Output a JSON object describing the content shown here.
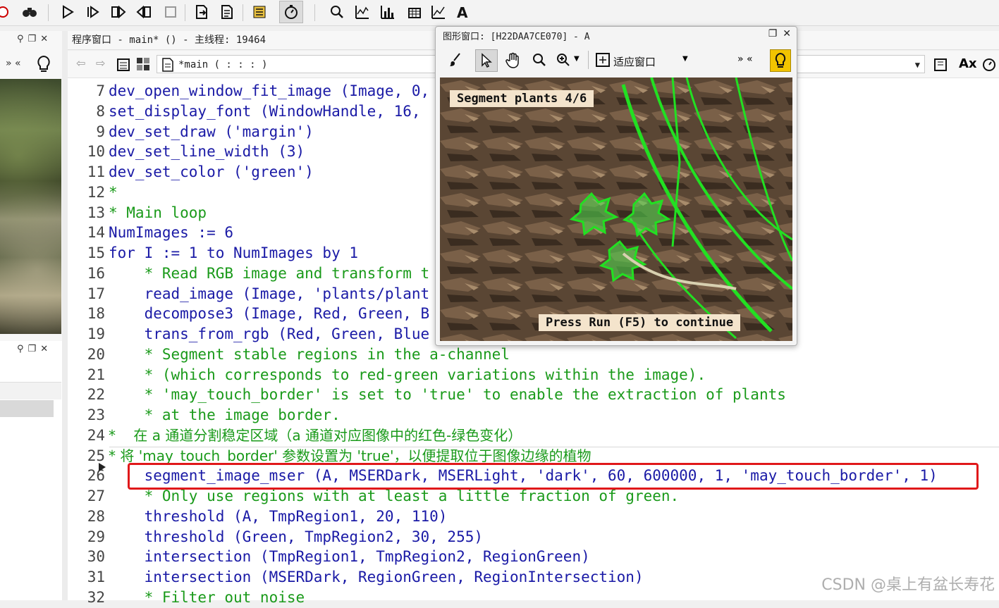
{
  "main_toolbar": {
    "icons": [
      "binoculars-icon",
      "run-icon",
      "step-over-icon",
      "step-into-icon",
      "step-out-icon",
      "stop-icon",
      "open-file-icon",
      "script-icon",
      "properties-icon",
      "profiler-icon",
      "zoom-icon",
      "histogram-icon",
      "line-profile-icon",
      "grid-icon",
      "graph-icon",
      "font-icon"
    ]
  },
  "program_window": {
    "title": "程序窗口 - main* () - 主线程: 19464",
    "procedure": "*main ( : : : )"
  },
  "graphics_window": {
    "title": "图形窗口: [H22DAA7CE070] - A",
    "fit_window_label": "适应窗口",
    "overlay_top": "Segment plants 4/6",
    "overlay_bottom": "Press Run (F5) to continue"
  },
  "code_lines": [
    {
      "n": "7",
      "text": "dev_open_window_fit_image (Image, 0,",
      "kind": "code"
    },
    {
      "n": "8",
      "text": "set_display_font (WindowHandle, 16,",
      "kind": "code"
    },
    {
      "n": "9",
      "text": "dev_set_draw ('margin')",
      "kind": "code"
    },
    {
      "n": "10",
      "text": "dev_set_line_width (3)",
      "kind": "code"
    },
    {
      "n": "11",
      "text": "dev_set_color ('green')",
      "kind": "code"
    },
    {
      "n": "12",
      "text": "*",
      "kind": "comment"
    },
    {
      "n": "13",
      "text": "* Main loop",
      "kind": "comment"
    },
    {
      "n": "14",
      "text": "NumImages := 6",
      "kind": "code"
    },
    {
      "n": "15",
      "text": "for I := 1 to NumImages by 1",
      "kind": "code"
    },
    {
      "n": "16",
      "text": "    * Read RGB image and transform t",
      "kind": "comment"
    },
    {
      "n": "17",
      "text": "    read_image (Image, 'plants/plant",
      "kind": "code"
    },
    {
      "n": "18",
      "text": "    decompose3 (Image, Red, Green, B",
      "kind": "code"
    },
    {
      "n": "19",
      "text": "    trans_from_rgb (Red, Green, Blue",
      "kind": "code"
    },
    {
      "n": "20",
      "text": "    * Segment stable regions in the a-channel",
      "kind": "comment"
    },
    {
      "n": "21",
      "text": "    * (which corresponds to red-green variations within the image).",
      "kind": "comment"
    },
    {
      "n": "22",
      "text": "    * 'may_touch_border' is set to 'true' to enable the extraction of plants",
      "kind": "comment"
    },
    {
      "n": "23",
      "text": "    * at the image border.",
      "kind": "comment"
    },
    {
      "n": "24",
      "text": "*    在 a 通道分割稳定区域（a 通道对应图像中的红色-绿色变化）",
      "kind": "cn"
    },
    {
      "n": "25",
      "text": "* 将 'may_touch_border' 参数设置为 'true'，以便提取位于图像边缘的植物",
      "kind": "cn"
    },
    {
      "n": "26",
      "text": "    segment_image_mser (A, MSERDark, MSERLight, 'dark', 60, 600000, 1, 'may_touch_border', 1)",
      "kind": "code"
    },
    {
      "n": "27",
      "text": "    * Only use regions with at least a little fraction of green.",
      "kind": "comment"
    },
    {
      "n": "28",
      "text": "    threshold (A, TmpRegion1, 20, 110)",
      "kind": "code"
    },
    {
      "n": "29",
      "text": "    threshold (Green, TmpRegion2, 30, 255)",
      "kind": "code"
    },
    {
      "n": "30",
      "text": "    intersection (TmpRegion1, TmpRegion2, RegionGreen)",
      "kind": "code"
    },
    {
      "n": "31",
      "text": "    intersection (MSERDark, RegionGreen, RegionIntersection)",
      "kind": "code"
    },
    {
      "n": "32",
      "text": "    * Filter out noise",
      "kind": "comment"
    }
  ],
  "watermark": "CSDN @桌上有盆长寿花",
  "colors": {
    "code": "#1a1aa6",
    "comment": "#1a9a1a",
    "highlight": "#e0181a",
    "segment": "#22e022"
  }
}
